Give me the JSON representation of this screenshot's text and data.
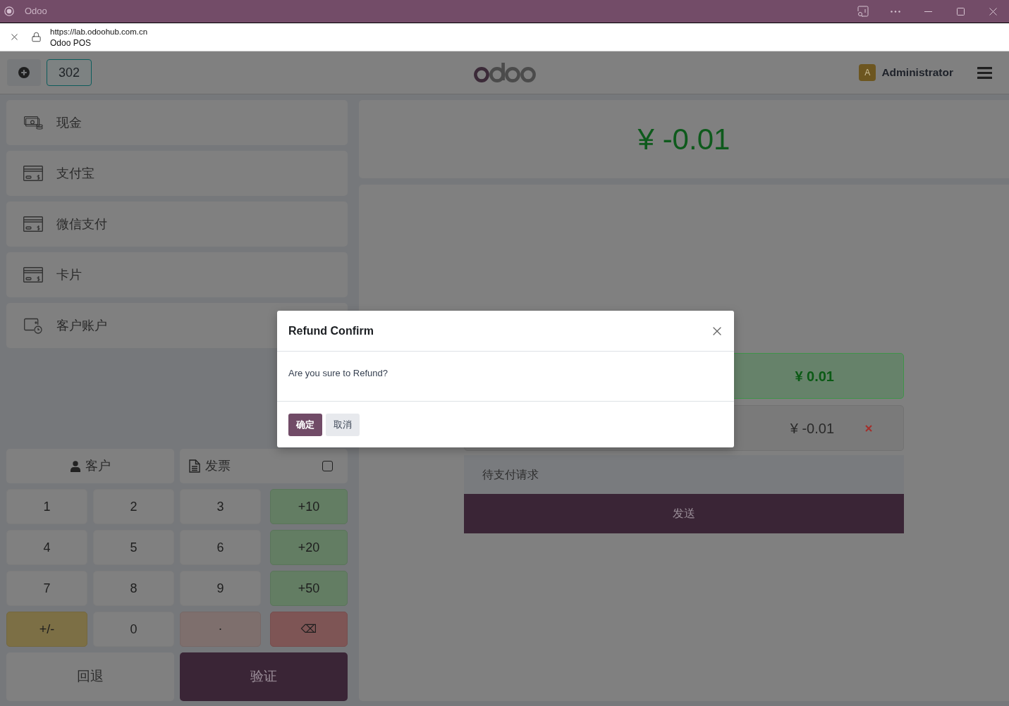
{
  "browser": {
    "title": "Odoo",
    "url": "https://lab.odoohub.com.cn",
    "page_title": "Odoo POS"
  },
  "header": {
    "order_number": "302",
    "user": {
      "initial": "A",
      "name": "Administrator"
    }
  },
  "payment_methods": [
    {
      "label": "现金",
      "kind": "cash"
    },
    {
      "label": "支付宝",
      "kind": "card"
    },
    {
      "label": "微信支付",
      "kind": "card"
    },
    {
      "label": "卡片",
      "kind": "card"
    },
    {
      "label": "客户账户",
      "kind": "account"
    }
  ],
  "customer_button": "客户",
  "invoice": {
    "label": "发票",
    "checked": false
  },
  "numpad": [
    {
      "label": "1",
      "kind": "digit"
    },
    {
      "label": "2",
      "kind": "digit"
    },
    {
      "label": "3",
      "kind": "digit"
    },
    {
      "label": "+10",
      "kind": "add"
    },
    {
      "label": "4",
      "kind": "digit"
    },
    {
      "label": "5",
      "kind": "digit"
    },
    {
      "label": "6",
      "kind": "digit"
    },
    {
      "label": "+20",
      "kind": "add"
    },
    {
      "label": "7",
      "kind": "digit"
    },
    {
      "label": "8",
      "kind": "digit"
    },
    {
      "label": "9",
      "kind": "digit"
    },
    {
      "label": "+50",
      "kind": "add"
    },
    {
      "label": "+/-",
      "kind": "sign"
    },
    {
      "label": "0",
      "kind": "digit"
    },
    {
      "label": ".",
      "kind": "decimal"
    },
    {
      "label": "⌫",
      "kind": "backspace"
    }
  ],
  "back_button": "回退",
  "validate_button": "验证",
  "total_due": "¥ -0.01",
  "payment_lines": [
    {
      "amount": "¥ 0.01",
      "selected": true,
      "removable": false
    },
    {
      "amount": "¥ -0.01",
      "selected": false,
      "removable": true
    }
  ],
  "pending_requests": {
    "label": "待支付请求",
    "send_button": "发送"
  },
  "dialog": {
    "title": "Refund Confirm",
    "message": "Are you sure to Refund?",
    "buttons": [
      {
        "label": "确定",
        "kind": "primary"
      },
      {
        "label": "取消",
        "kind": "secondary"
      }
    ]
  }
}
